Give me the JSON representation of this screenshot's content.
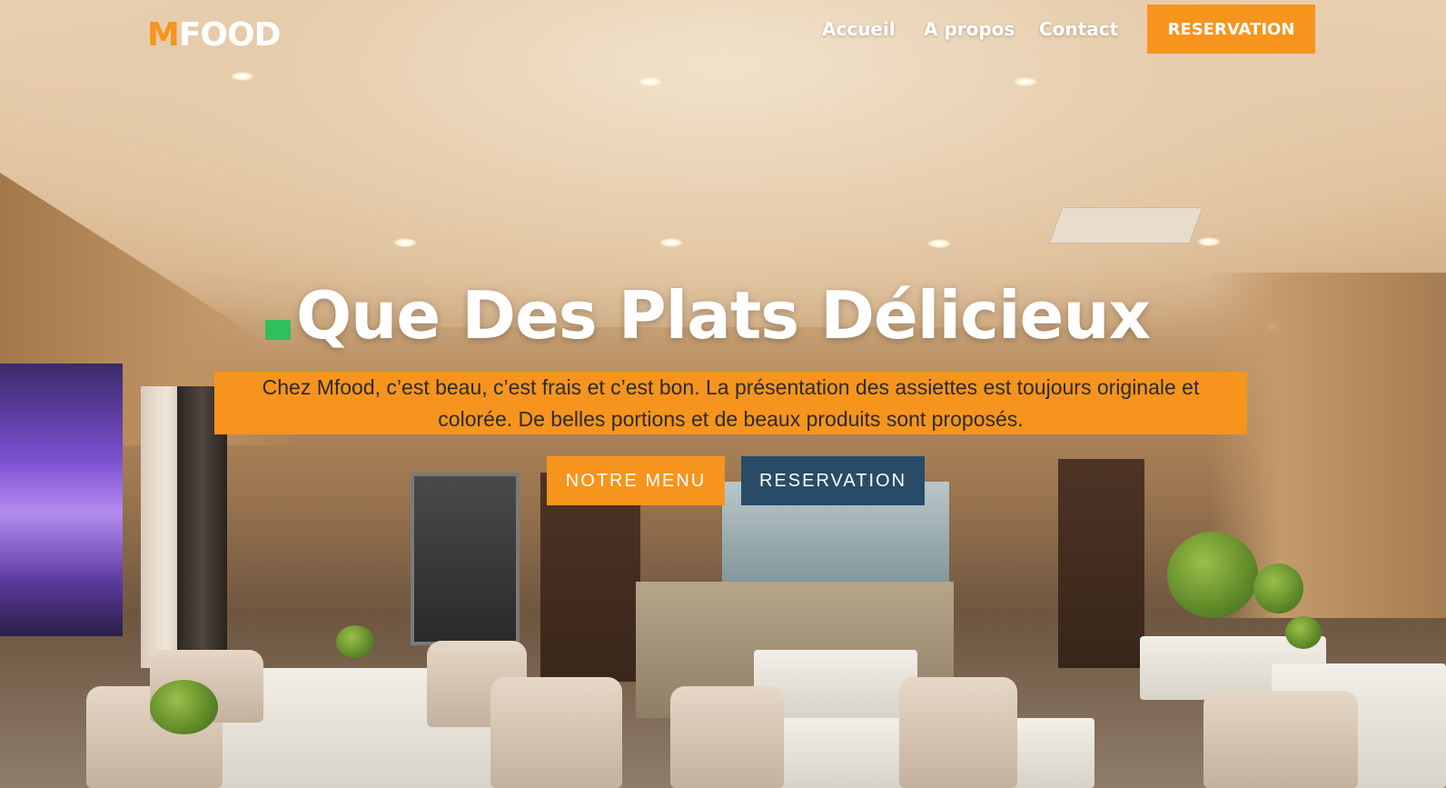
{
  "brand": {
    "logo_first": "M",
    "logo_rest": "FOOD",
    "accent_color": "#f7941d",
    "secondary_color": "#284b68"
  },
  "nav": {
    "items": [
      {
        "label": "Accueil"
      },
      {
        "label": "A propos"
      },
      {
        "label": "Contact"
      }
    ],
    "cta_label": "RESERVATION"
  },
  "hero": {
    "headline": "Que Des Plats Délicieux",
    "subtitle": "Chez Mfood, c’est beau, c’est frais et c’est bon. La présentation des assiettes est toujours originale et colorée. De belles portions et de beaux produits sont proposés.",
    "buttons": {
      "menu_label": "NOTRE MENU",
      "reservation_label": "RESERVATION"
    }
  }
}
